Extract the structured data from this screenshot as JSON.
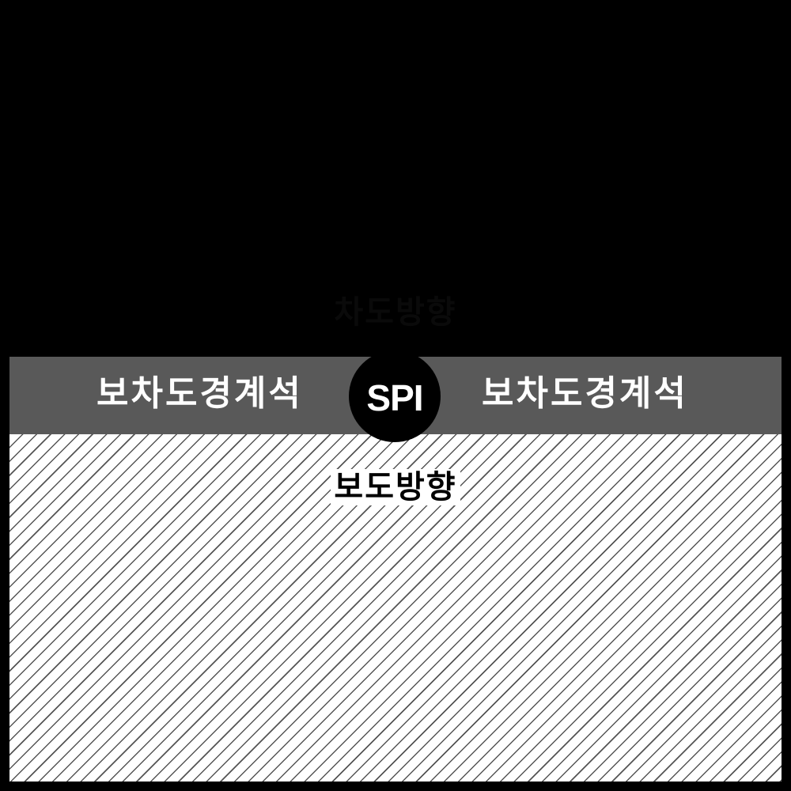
{
  "roadway": {
    "label": "차도방향"
  },
  "curb": {
    "left_label": "보차도경계석",
    "right_label": "보차도경계석"
  },
  "sidewalk": {
    "label": "보도방향"
  },
  "logo": {
    "text": "SPI"
  },
  "colors": {
    "roadway": "#000000",
    "curb_band": "#595959",
    "sidewalk_hatch": "#555555",
    "sidewalk_bg": "#ffffff",
    "logo_bg": "#000000"
  }
}
